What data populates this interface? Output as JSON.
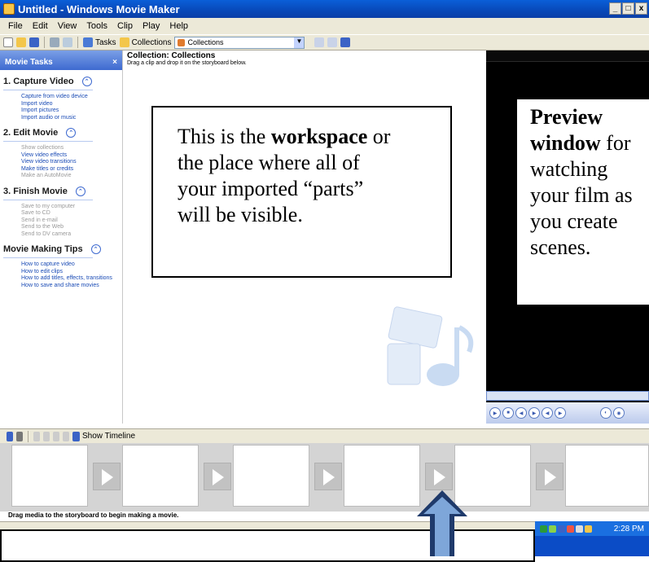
{
  "window": {
    "title": "Untitled - Windows Movie Maker",
    "controls": [
      "_",
      "□",
      "x"
    ]
  },
  "menu": [
    "File",
    "Edit",
    "View",
    "Tools",
    "Clip",
    "Play",
    "Help"
  ],
  "toolbar": {
    "tasks_label": "Tasks",
    "collections_label": "Collections",
    "collection_select": "Collections"
  },
  "task_pane": {
    "header": "Movie Tasks",
    "close": "×",
    "sections": [
      {
        "title": "1. Capture Video",
        "links": [
          {
            "label": "Capture from video device",
            "enabled": true
          },
          {
            "label": "Import video",
            "enabled": true
          },
          {
            "label": "Import pictures",
            "enabled": true
          },
          {
            "label": "Import audio or music",
            "enabled": true
          }
        ]
      },
      {
        "title": "2. Edit Movie",
        "links": [
          {
            "label": "Show collections",
            "enabled": false
          },
          {
            "label": "View video effects",
            "enabled": true
          },
          {
            "label": "View video transitions",
            "enabled": true
          },
          {
            "label": "Make titles or credits",
            "enabled": true
          },
          {
            "label": "Make an AutoMovie",
            "enabled": false
          }
        ]
      },
      {
        "title": "3. Finish Movie",
        "links": [
          {
            "label": "Save to my computer",
            "enabled": false
          },
          {
            "label": "Save to CD",
            "enabled": false
          },
          {
            "label": "Send in e-mail",
            "enabled": false
          },
          {
            "label": "Send to the Web",
            "enabled": false
          },
          {
            "label": "Send to DV camera",
            "enabled": false
          }
        ]
      },
      {
        "title": "Movie Making Tips",
        "links": [
          {
            "label": "How to capture video",
            "enabled": true
          },
          {
            "label": "How to edit clips",
            "enabled": true
          },
          {
            "label": "How to add titles, effects, transitions",
            "enabled": true
          },
          {
            "label": "How to save and share movies",
            "enabled": true
          }
        ]
      }
    ]
  },
  "workspace": {
    "title": "Collection: Collections",
    "subtitle": "Drag a clip and drop it on the storyboard below.",
    "callout": {
      "l1_pre": "This is the ",
      "l1_bold": "workspace",
      "l1_post": " or",
      "l2": "the place where all of",
      "l3": "your imported “parts”",
      "l4": "will be visible."
    }
  },
  "preview": {
    "callout": {
      "l1": "Preview",
      "l2_bold": "window",
      "l2_post": " for",
      "l3": "watching",
      "l4": "your film as",
      "l5": "you create",
      "l6": "scenes."
    }
  },
  "storyboard": {
    "show_timeline": "Show Timeline",
    "hint": "Drag media to the storyboard to begin making a movie.",
    "frame_count": 6
  },
  "tray": {
    "clock": "2:28 PM"
  },
  "colors": {
    "title_blue": "#0848b8",
    "link_blue": "#1a4bb5",
    "arrow_navy": "#1f3a6b",
    "arrow_fill": "#7ea6d9"
  }
}
